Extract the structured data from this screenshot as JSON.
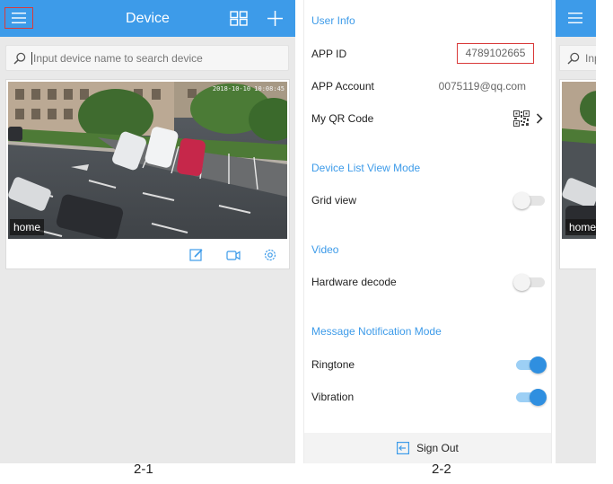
{
  "panel1": {
    "title": "Device",
    "search": {
      "placeholder": "Input device name to search device"
    },
    "device": {
      "name": "home",
      "timestamp": "2018-10-10 10:08:45"
    }
  },
  "panel2": {
    "sections": {
      "user_info": "User Info",
      "device_list_view_mode": "Device List View Mode",
      "video": "Video",
      "message_notification_mode": "Message Notification Mode"
    },
    "rows": {
      "app_id_label": "APP ID",
      "app_id_value": "4789102665",
      "app_account_label": "APP Account",
      "app_account_value": "0075119@qq.com",
      "qr_code_label": "My QR Code",
      "grid_view_label": "Grid view",
      "hardware_decode_label": "Hardware decode",
      "ringtone_label": "Ringtone",
      "vibration_label": "Vibration"
    },
    "toggles": {
      "grid_view": false,
      "hardware_decode": false,
      "ringtone": true,
      "vibration": true
    },
    "sign_out_label": "Sign Out"
  },
  "panel3": {
    "search_partial": "Inp",
    "device_name": "home"
  },
  "captions": [
    "2-1",
    "2-2"
  ],
  "colors": {
    "brand": "#3d9be9",
    "highlight": "#d93a3a",
    "toggle_on": "#2f8fe0"
  },
  "icons": [
    "menu-icon",
    "grid-view-icon",
    "add-icon",
    "search-icon",
    "edit-icon",
    "video-record-icon",
    "settings-icon",
    "qr-code-icon",
    "chevron-right-icon",
    "sign-out-icon"
  ]
}
